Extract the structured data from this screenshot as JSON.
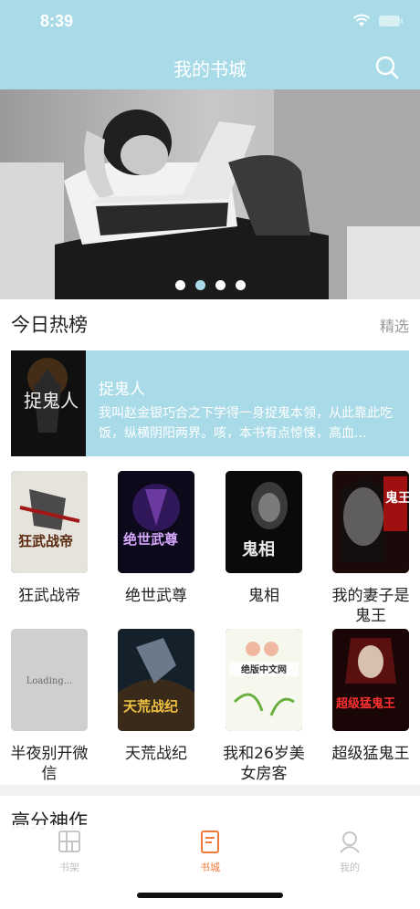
{
  "status": {
    "time": "8:39"
  },
  "nav": {
    "title": "我的书城"
  },
  "hot": {
    "title": "今日热榜",
    "more": "精选",
    "featured": {
      "title": "捉鬼人",
      "description": "我叫赵金银巧合之下学得一身捉鬼本领，从此靠此吃饭，纵横阴阳两界。咳，本书有点惊悚，高血...",
      "cover_text": "捉鬼人"
    },
    "books": [
      {
        "title": "狂武战帝",
        "cover_text": "狂武战帝"
      },
      {
        "title": "绝世武尊",
        "cover_text": "绝世武尊"
      },
      {
        "title": "鬼相",
        "cover_text": "鬼相"
      },
      {
        "title": "我的妻子是鬼王",
        "cover_text": "鬼王"
      },
      {
        "title": "半夜别开微信",
        "cover_text": "Loading..."
      },
      {
        "title": "天荒战纪",
        "cover_text": "天荒战纪"
      },
      {
        "title": "我和26岁美女房客",
        "cover_text": "绝版中文网"
      },
      {
        "title": "超级猛鬼王",
        "cover_text": "超级猛鬼王"
      }
    ]
  },
  "high_score": {
    "title": "高分神作"
  },
  "tabs": [
    {
      "label": "书架",
      "icon": "bookshelf-icon",
      "active": false
    },
    {
      "label": "书城",
      "icon": "bookstore-icon",
      "active": true
    },
    {
      "label": "我的",
      "icon": "profile-icon",
      "active": false
    }
  ],
  "colors": {
    "accent": "#a8dbe7",
    "tab_active": "#f07a3a",
    "tab_inactive": "#c0c0c0"
  },
  "banner": {
    "slides": 4,
    "active_index": 1
  }
}
